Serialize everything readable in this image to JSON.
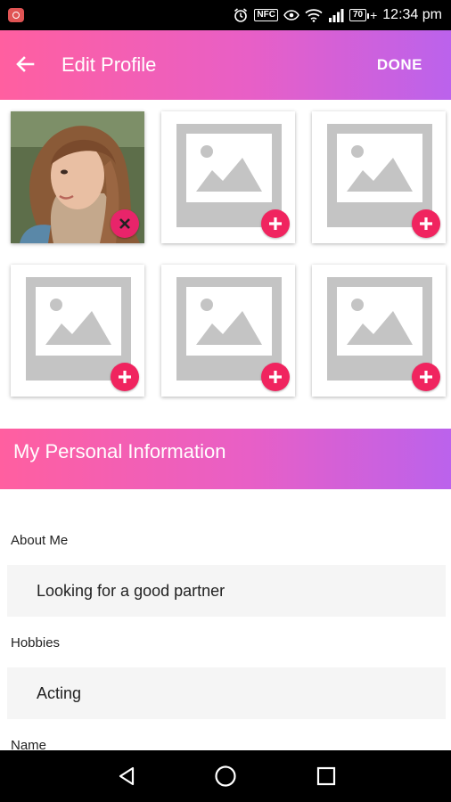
{
  "status_bar": {
    "nfc": "NFC",
    "battery": "70",
    "time": "12:34 pm"
  },
  "app_bar": {
    "title": "Edit Profile",
    "done_label": "DONE",
    "background_start": "#ff5fa0",
    "background_end": "#bb62ec"
  },
  "photos": {
    "slots": [
      {
        "state": "filled",
        "action_icon": "close-icon"
      },
      {
        "state": "empty",
        "action_icon": "plus-icon"
      },
      {
        "state": "empty",
        "action_icon": "plus-icon"
      },
      {
        "state": "empty",
        "action_icon": "plus-icon"
      },
      {
        "state": "empty",
        "action_icon": "plus-icon"
      },
      {
        "state": "empty",
        "action_icon": "plus-icon"
      }
    ],
    "add_button_color": "#f0245f"
  },
  "section": {
    "title": "My Personal Information"
  },
  "form": {
    "about_label": "About Me",
    "about_value": "Looking for a good partner",
    "hobbies_label": "Hobbies",
    "hobbies_value": "Acting",
    "name_label": "Name"
  }
}
